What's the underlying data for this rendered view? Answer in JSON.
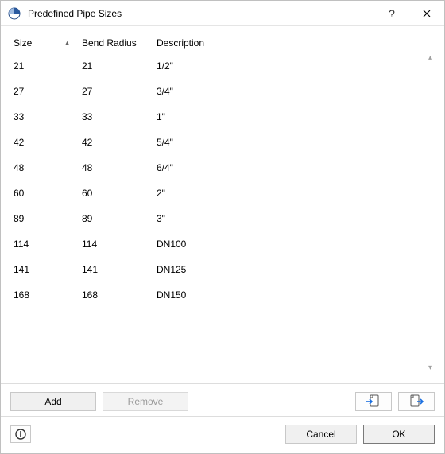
{
  "window": {
    "title": "Predefined Pipe Sizes"
  },
  "table": {
    "headers": {
      "size": "Size",
      "bend": "Bend Radius",
      "desc": "Description"
    },
    "rows": [
      {
        "size": "21",
        "bend": "21",
        "desc": "1/2\""
      },
      {
        "size": "27",
        "bend": "27",
        "desc": "3/4\""
      },
      {
        "size": "33",
        "bend": "33",
        "desc": "1\""
      },
      {
        "size": "42",
        "bend": "42",
        "desc": "5/4\""
      },
      {
        "size": "48",
        "bend": "48",
        "desc": "6/4\""
      },
      {
        "size": "60",
        "bend": "60",
        "desc": "2\""
      },
      {
        "size": "89",
        "bend": "89",
        "desc": "3\""
      },
      {
        "size": "114",
        "bend": "114",
        "desc": "DN100"
      },
      {
        "size": "141",
        "bend": "141",
        "desc": "DN125"
      },
      {
        "size": "168",
        "bend": "168",
        "desc": "DN150"
      }
    ]
  },
  "buttons": {
    "add": "Add",
    "remove": "Remove",
    "cancel": "Cancel",
    "ok": "OK"
  }
}
